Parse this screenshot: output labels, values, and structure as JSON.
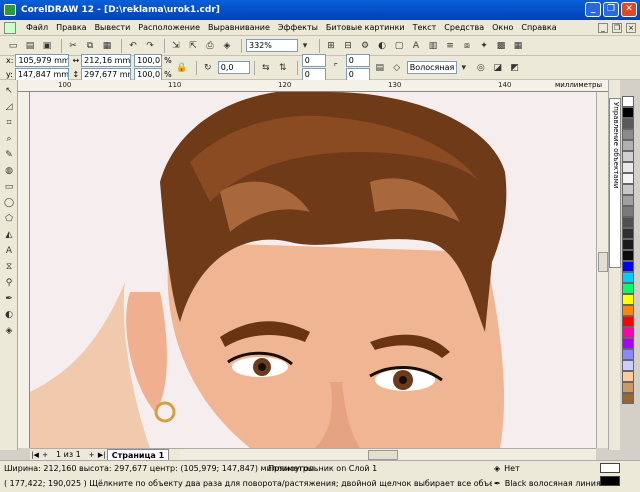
{
  "window": {
    "title": "CorelDRAW 12 - [D:\\reklama\\urok1.cdr]",
    "buttons": [
      "_",
      "❐",
      "✕"
    ]
  },
  "menu": {
    "items": [
      "Файл",
      "Правка",
      "Вывести",
      "Расположение",
      "Выравнивание",
      "Эффекты",
      "Битовые картинки",
      "Текст",
      "Средства",
      "Окно",
      "Справка"
    ]
  },
  "toolbar": {
    "zoom": "332%"
  },
  "property_bar": {
    "x": "105,979 mm",
    "y": "147,847 mm",
    "width": "212,16 mm",
    "height": "297,677 mm",
    "scale_x": "100,0",
    "scale_y": "100,0",
    "percent": "%",
    "rotation": "0,0",
    "corner_1": "0",
    "corner_2": "0",
    "corner_3": "0",
    "corner_4": "0",
    "outline": "Волосяная"
  },
  "ruler": {
    "ticks": [
      "100",
      "110",
      "120",
      "130",
      "140",
      "150"
    ],
    "units": "миллиметры"
  },
  "page_nav": {
    "count": "1 из 1",
    "page_tab": "Страница 1"
  },
  "docker": {
    "label": "Управление объектами"
  },
  "palette": {
    "colors": [
      "#ffffff",
      "#000000",
      "#5a5a5a",
      "#8a8a8a",
      "#b0b0b0",
      "#d0d0d0",
      "#e8e8e8",
      "#f4f4f4",
      "#c8c8c8",
      "#a0a0a0",
      "#7a7a7a",
      "#505050",
      "#303030",
      "#1a1a1a",
      "#0d0d0d",
      "#0000ff",
      "#00ccff",
      "#00ff66",
      "#ffff00",
      "#ff8800",
      "#ff0000",
      "#ff00aa",
      "#aa00ff",
      "#8888ff",
      "#ccccff",
      "#ffcc99",
      "#cc9966",
      "#996633"
    ]
  },
  "status": {
    "line1": "Ширина: 212,160 высота: 297,677 центр: (105,979; 147,847) миллиметры",
    "layer": "Прямоугольник on Слой 1",
    "line2": "( 177,422; 190,025 )   Щёлкните по объекту два раза для поворота/растяжения; двойной щелчок выбирает все объекты; Shift+щелчок - выбор не...",
    "fill": "Нет",
    "outline": "Black  волосяная линия"
  }
}
